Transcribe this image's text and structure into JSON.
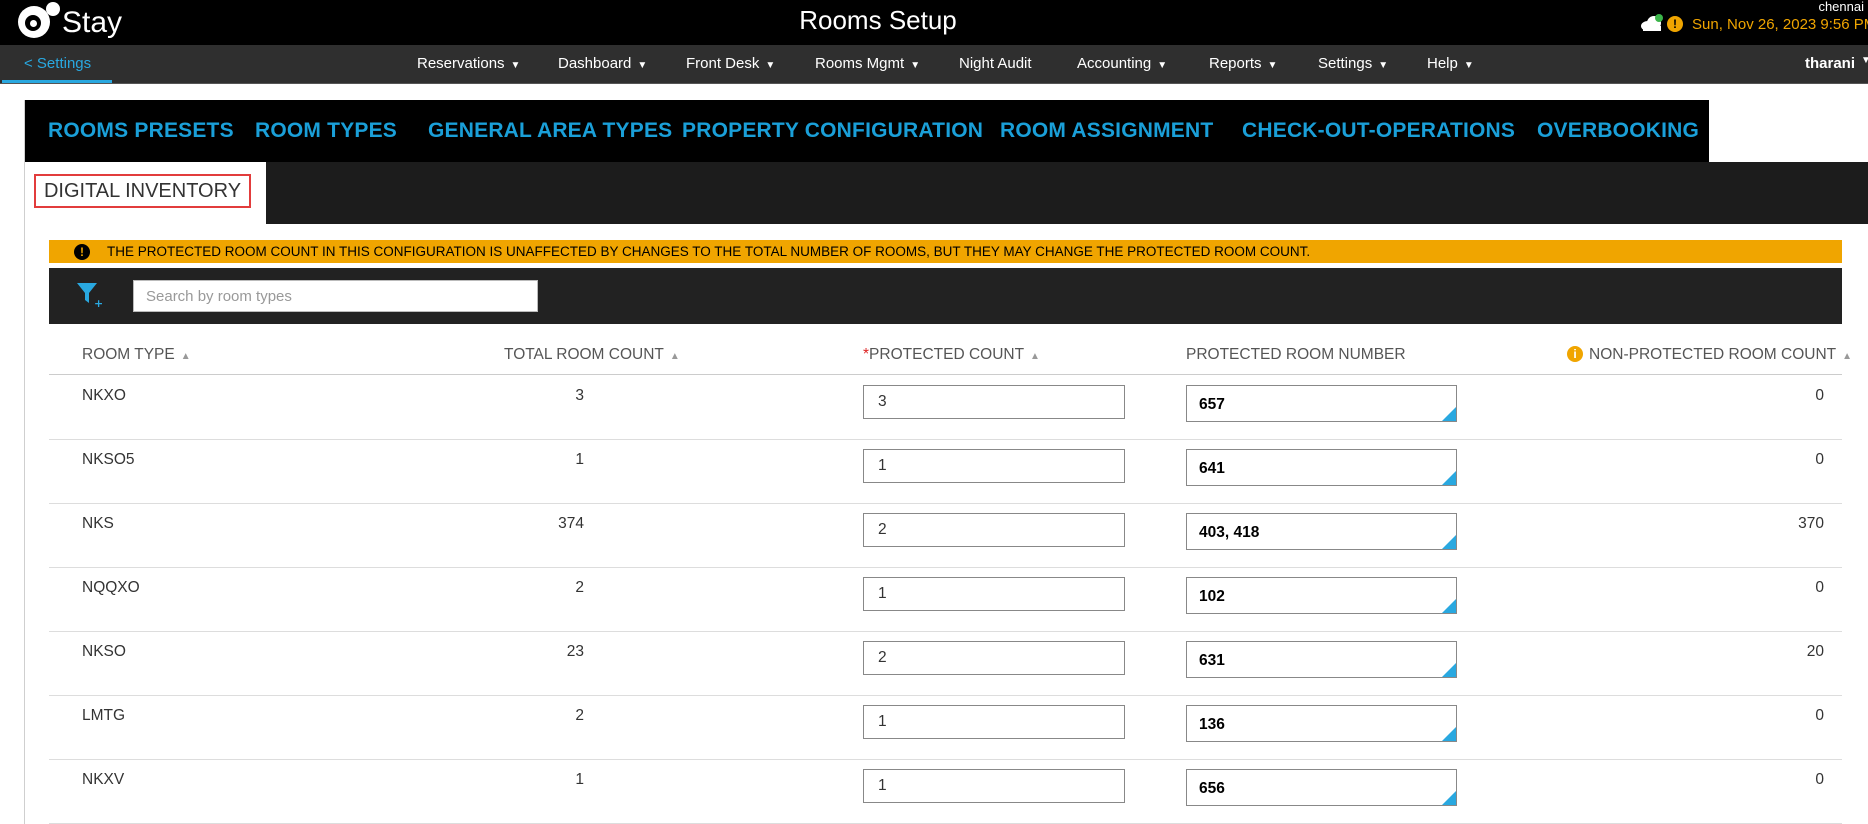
{
  "header": {
    "logo_text": "Stay",
    "title": "Rooms Setup",
    "user_location": "chennai",
    "datetime": "Sun, Nov 26, 2023 9:56 PM"
  },
  "nav": {
    "back_label": "< Settings",
    "items": [
      {
        "label": "Reservations",
        "caret": true
      },
      {
        "label": "Dashboard",
        "caret": true
      },
      {
        "label": "Front Desk",
        "caret": true
      },
      {
        "label": "Rooms Mgmt",
        "caret": true
      },
      {
        "label": "Night Audit",
        "caret": false
      },
      {
        "label": "Accounting",
        "caret": true
      },
      {
        "label": "Reports",
        "caret": true
      },
      {
        "label": "Settings",
        "caret": true
      },
      {
        "label": "Help",
        "caret": true
      }
    ],
    "user": "tharani"
  },
  "tabs": [
    "ROOMS PRESETS",
    "ROOM TYPES",
    "GENERAL AREA TYPES",
    "PROPERTY CONFIGURATION",
    "ROOM ASSIGNMENT",
    "CHECK-OUT-OPERATIONS",
    "OVERBOOKING"
  ],
  "active_tab": "DIGITAL INVENTORY",
  "warning_text": "THE PROTECTED ROOM COUNT IN THIS CONFIGURATION IS UNAFFECTED BY CHANGES TO THE TOTAL NUMBER OF ROOMS, BUT THEY MAY CHANGE THE PROTECTED ROOM COUNT.",
  "search": {
    "placeholder": "Search by room types",
    "value": ""
  },
  "columns": {
    "room_type": "ROOM TYPE",
    "total_room_count": "TOTAL ROOM COUNT",
    "protected_count_required": "*",
    "protected_count": "PROTECTED COUNT",
    "protected_room_number": "PROTECTED ROOM NUMBER",
    "non_protected_room_count": "NON-PROTECTED ROOM COUNT"
  },
  "rows": [
    {
      "room_type": "NKXO",
      "total": "3",
      "protected_count": "3",
      "room_numbers": "657",
      "non_protected": "0"
    },
    {
      "room_type": "NKSO5",
      "total": "1",
      "protected_count": "1",
      "room_numbers": "641",
      "non_protected": "0"
    },
    {
      "room_type": "NKS",
      "total": "374",
      "protected_count": "2",
      "room_numbers": "403, 418",
      "non_protected": "370"
    },
    {
      "room_type": "NQQXO",
      "total": "2",
      "protected_count": "1",
      "room_numbers": "102",
      "non_protected": "0"
    },
    {
      "room_type": "NKSO",
      "total": "23",
      "protected_count": "2",
      "room_numbers": "631",
      "non_protected": "20"
    },
    {
      "room_type": "LMTG",
      "total": "2",
      "protected_count": "1",
      "room_numbers": "136",
      "non_protected": "0"
    },
    {
      "room_type": "NKXV",
      "total": "1",
      "protected_count": "1",
      "room_numbers": "656",
      "non_protected": "0"
    }
  ],
  "colors": {
    "accent": "#1a9fd8",
    "warning": "#f0a500",
    "highlight_border": "#e23c3c"
  }
}
